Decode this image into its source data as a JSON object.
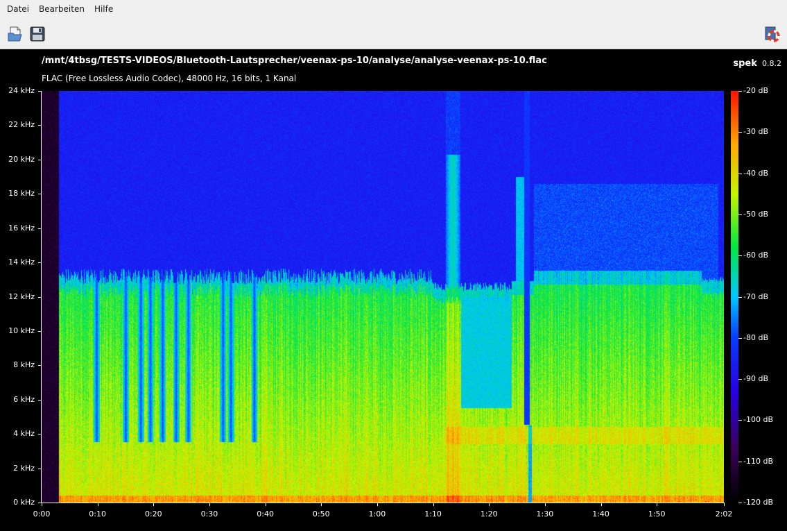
{
  "menu": [
    "Datei",
    "Bearbeiten",
    "Hilfe"
  ],
  "toolbar": {
    "open_icon": "open-file-icon",
    "save_icon": "save-icon",
    "about_icon": "about-lifebuoy-icon"
  },
  "file": {
    "path": "/mnt/4tbsg/TESTS-VIDEOS/Bluetooth-Lautsprecher/veenax-ps-10/analyse/analyse-veenax-ps-10.flac",
    "info": "FLAC (Free Lossless Audio Codec), 48000 Hz, 16 bits, 1 Kanal"
  },
  "brand": {
    "name": "spek",
    "version": "0.8.2"
  },
  "freq_axis": {
    "labels": [
      "24 kHz",
      "22 kHz",
      "20 kHz",
      "18 kHz",
      "16 kHz",
      "14 kHz",
      "12 kHz",
      "10 kHz",
      "8 kHz",
      "6 kHz",
      "4 kHz",
      "2 kHz",
      "0 kHz"
    ],
    "max_khz": 24
  },
  "time_axis": {
    "labels": [
      "0:00",
      "0:10",
      "0:20",
      "0:30",
      "0:40",
      "0:50",
      "1:00",
      "1:10",
      "1:20",
      "1:30",
      "1:40",
      "1:50",
      "2:02"
    ],
    "seconds": [
      0,
      10,
      20,
      30,
      40,
      50,
      60,
      70,
      80,
      90,
      100,
      110,
      122
    ],
    "duration_s": 122
  },
  "db_scale": {
    "labels": [
      "-20 dB",
      "-30 dB",
      "-40 dB",
      "-50 dB",
      "-60 dB",
      "-70 dB",
      "-80 dB",
      "-90 dB",
      "-100 dB",
      "-110 dB",
      "-120 dB"
    ],
    "max_db": -20,
    "min_db": -120
  }
}
